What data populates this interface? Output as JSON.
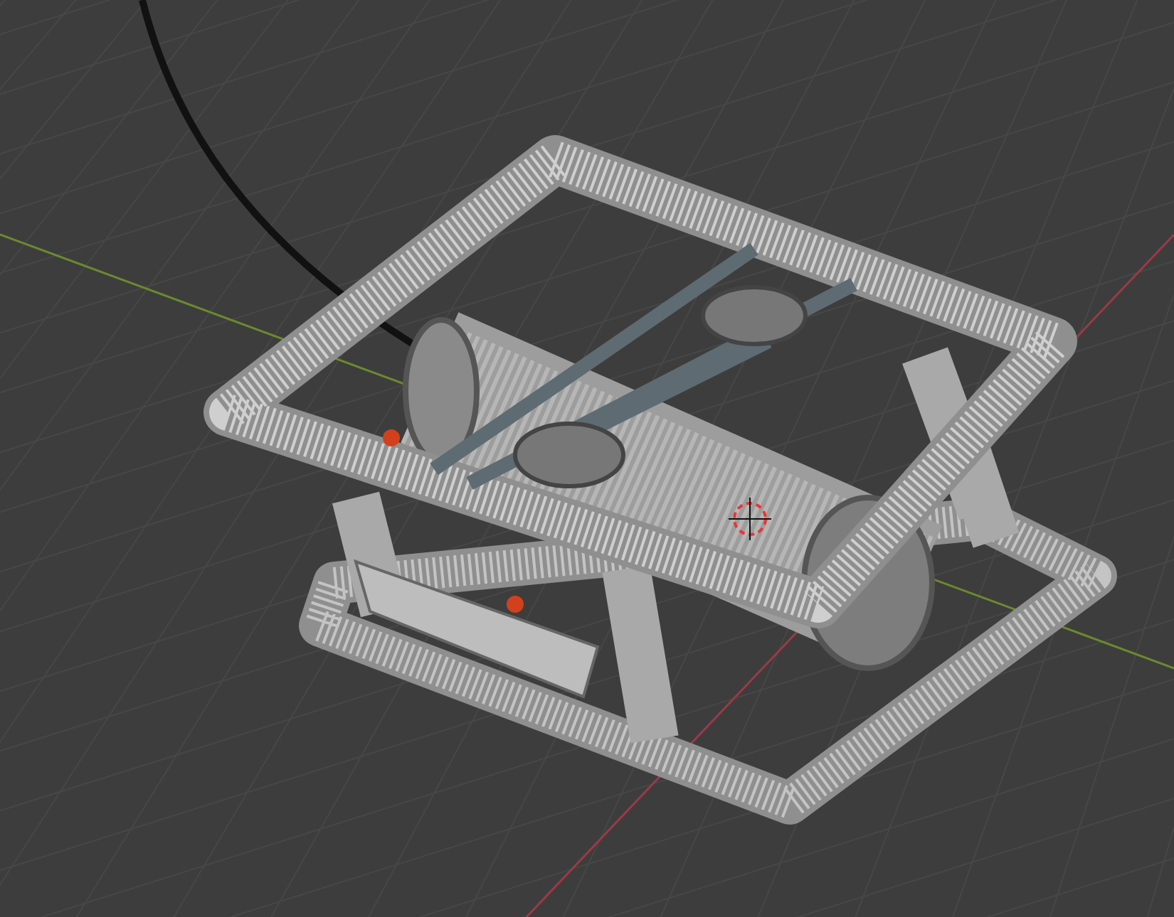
{
  "viewport": {
    "grid": true,
    "axes": true,
    "cursor": true,
    "model": true
  }
}
